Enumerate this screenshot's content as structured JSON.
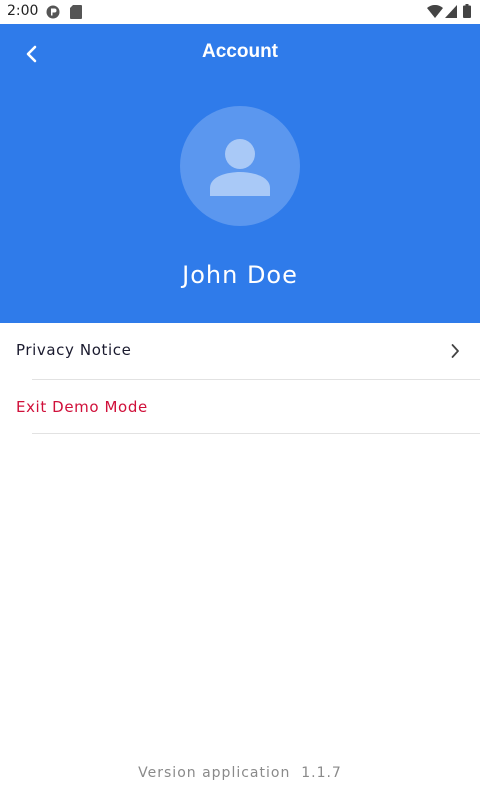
{
  "status_bar": {
    "time": "2:00",
    "icons": [
      "app-notification-icon",
      "sd-card-icon",
      "wifi-icon",
      "signal-icon",
      "battery-icon"
    ]
  },
  "header": {
    "title": "Account",
    "back_icon": "chevron-left-icon",
    "avatar_icon": "person-icon",
    "user_name": "John Doe",
    "background_color": "#2f7bea"
  },
  "menu": {
    "items": [
      {
        "label": "Privacy Notice",
        "color": "#1a1a2e",
        "has_chevron": true
      },
      {
        "label": "Exit Demo Mode",
        "color": "#d0103a",
        "has_chevron": false
      }
    ]
  },
  "footer": {
    "version_text": "Version application  1.1.7"
  }
}
